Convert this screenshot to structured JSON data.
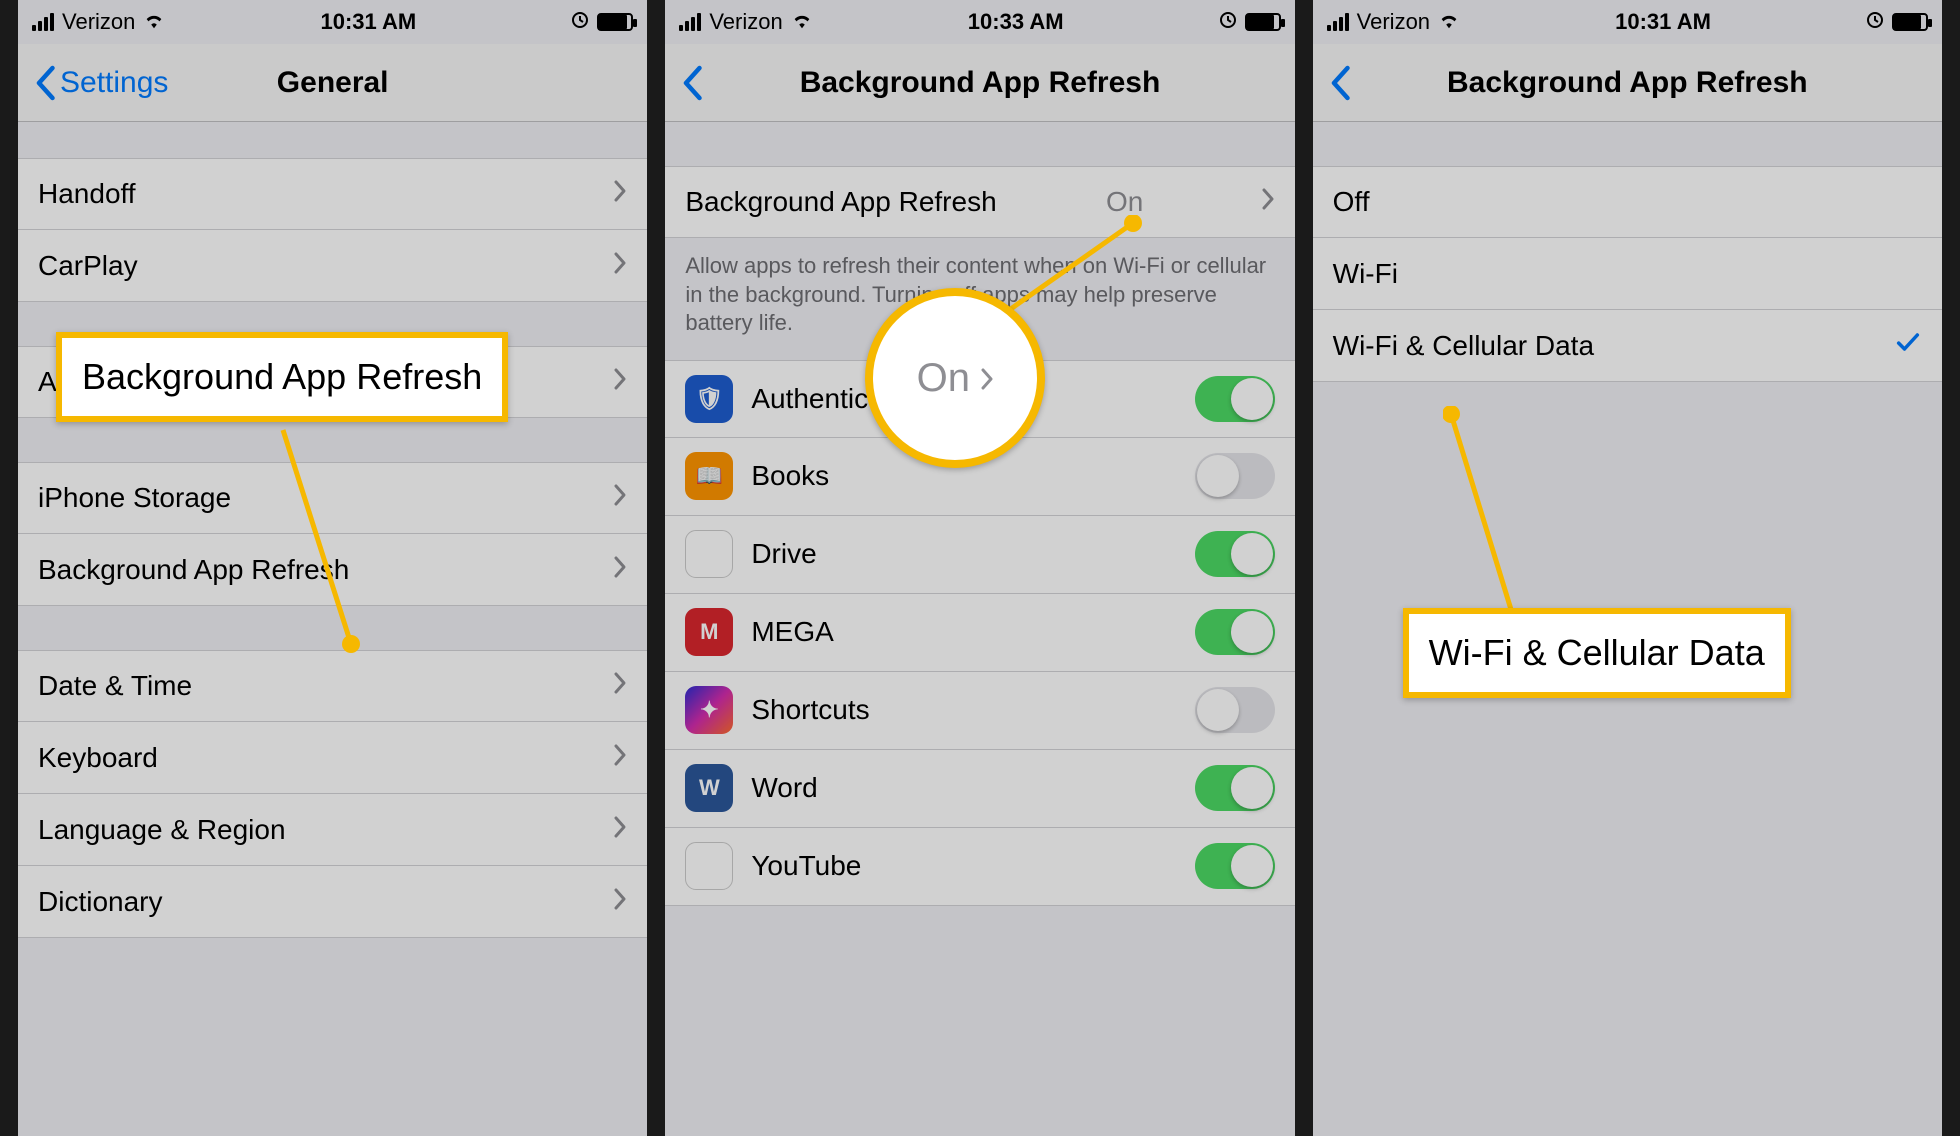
{
  "statusbar": {
    "carrier": "Verizon"
  },
  "phone1": {
    "time": "10:31 AM",
    "back": "Settings",
    "title": "General",
    "rows1": [
      "Handoff",
      "CarPlay"
    ],
    "rows2": [
      "Accessibility"
    ],
    "rows3": [
      "iPhone Storage",
      "Background App Refresh"
    ],
    "rows4": [
      "Date & Time",
      "Keyboard",
      "Language & Region",
      "Dictionary"
    ],
    "callout": "Background App Refresh"
  },
  "phone2": {
    "time": "10:33 AM",
    "title": "Background App Refresh",
    "master": {
      "label": "Background App Refresh",
      "value": "On"
    },
    "footer": "Allow apps to refresh their content when on Wi-Fi or cellular in the background. Turning off apps may help preserve battery life.",
    "apps": [
      {
        "name": "Authenticator",
        "on": true,
        "iconClass": "ic-auth",
        "glyph": "🛡"
      },
      {
        "name": "Books",
        "on": false,
        "iconClass": "ic-books",
        "glyph": "📖"
      },
      {
        "name": "Drive",
        "on": true,
        "iconClass": "ic-drive",
        "glyph": "▲"
      },
      {
        "name": "MEGA",
        "on": true,
        "iconClass": "ic-mega",
        "glyph": "M"
      },
      {
        "name": "Shortcuts",
        "on": false,
        "iconClass": "ic-shortcuts",
        "glyph": "✦"
      },
      {
        "name": "Word",
        "on": true,
        "iconClass": "ic-word",
        "glyph": "W"
      },
      {
        "name": "YouTube",
        "on": true,
        "iconClass": "ic-youtube",
        "glyph": "▶"
      }
    ],
    "callout": "On"
  },
  "phone3": {
    "time": "10:31 AM",
    "title": "Background App Refresh",
    "options": [
      "Off",
      "Wi-Fi",
      "Wi-Fi & Cellular Data"
    ],
    "selectedIndex": 2,
    "callout": "Wi-Fi & Cellular Data"
  }
}
